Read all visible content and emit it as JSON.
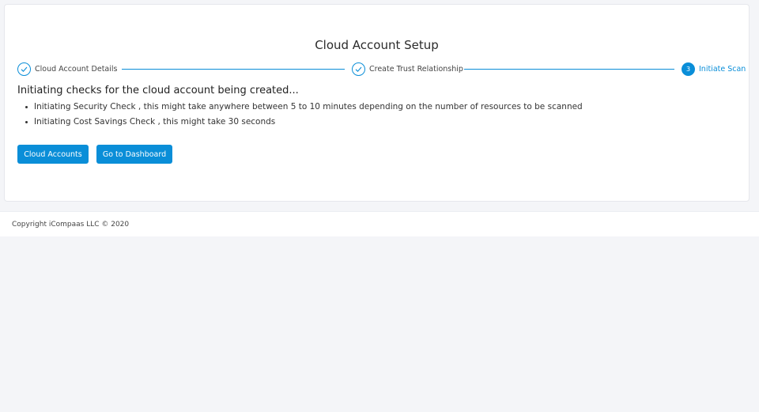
{
  "page": {
    "title": "Cloud Account Setup"
  },
  "colors": {
    "accent": "#0a8ed8",
    "background": "#f4f5f8",
    "card": "#ffffff"
  },
  "steps": [
    {
      "label": "Cloud Account Details",
      "status": "completed",
      "icon": "check-icon"
    },
    {
      "label": "Create Trust Relationship",
      "status": "completed",
      "icon": "check-icon"
    },
    {
      "number": "3",
      "label": "Initiate Scan",
      "status": "active"
    }
  ],
  "content": {
    "heading": "Initiating checks for the cloud account being created...",
    "items": [
      "Initiating Security Check , this might take anywhere between 5 to 10 minutes depending on the number of resources to be scanned",
      "Initiating Cost Savings Check , this might take 30 seconds"
    ]
  },
  "buttons": {
    "cloud_accounts": "Cloud Accounts",
    "dashboard": "Go to Dashboard"
  },
  "footer": {
    "copyright": "Copyright iCompaas LLC © 2020"
  }
}
